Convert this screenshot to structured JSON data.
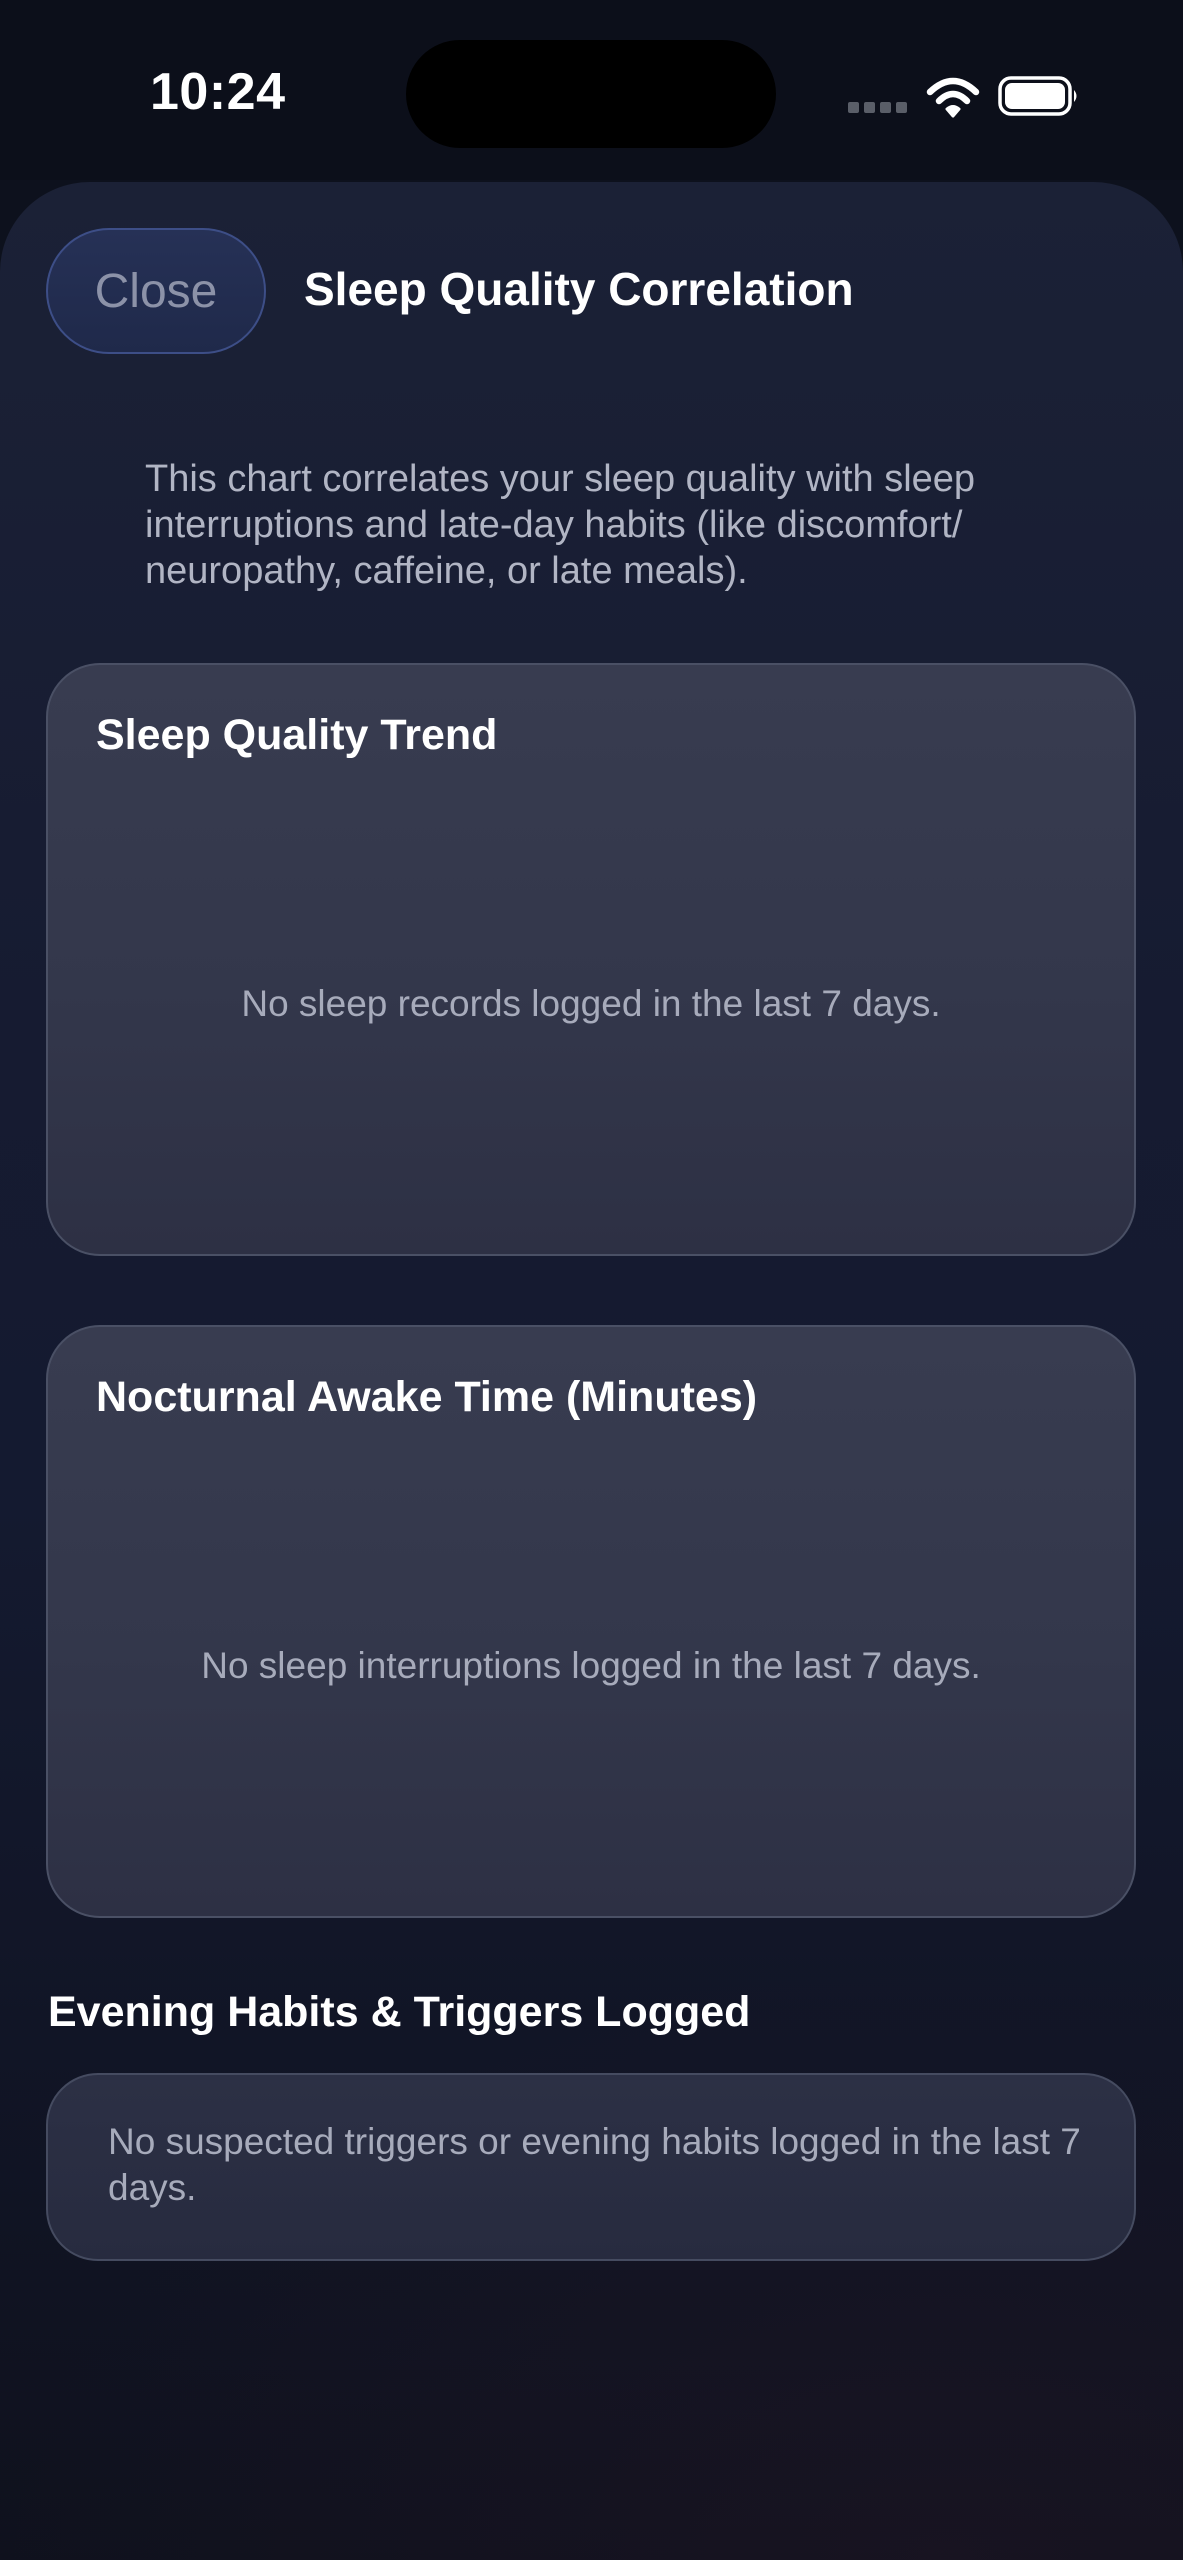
{
  "status_bar": {
    "time": "10:24"
  },
  "header": {
    "close_label": "Close",
    "title": "Sleep Quality Correlation"
  },
  "intro": {
    "text": "This chart correlates your sleep quality with sleep interruptions and late-day habits (like discomfort/ neuropathy, caffeine, or late meals)."
  },
  "cards": {
    "quality": {
      "title": "Sleep Quality Trend",
      "empty": "No sleep records logged in the last 7 days."
    },
    "awake": {
      "title": "Nocturnal Awake Time (Minutes)",
      "empty": "No sleep interruptions logged in the last 7 days."
    }
  },
  "habits": {
    "title": "Evening Habits & Triggers Logged",
    "empty": "No suspected triggers or evening habits logged in the last 7 days."
  },
  "icons": {
    "signal": "cellular-signal-icon",
    "wifi": "wifi-icon",
    "battery": "battery-icon"
  }
}
